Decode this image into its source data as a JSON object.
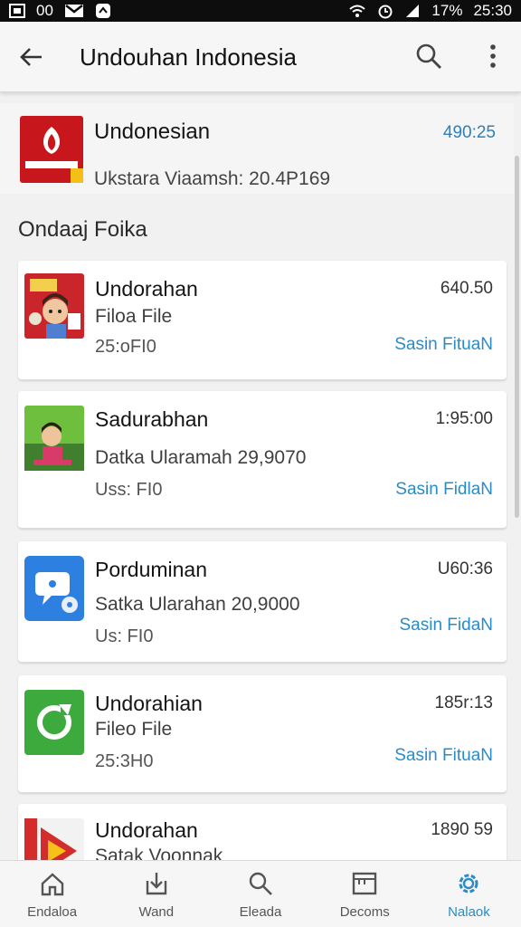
{
  "status_bar": {
    "left_text": "00",
    "battery": "17%",
    "time": "25:30"
  },
  "app_bar": {
    "title": "Undouhan Indonesia"
  },
  "header": {
    "title": "Undonesian",
    "time": "490:25",
    "subtitle": "Ukstara Viaamsh: 20.4P169"
  },
  "section": {
    "title": "Ondaaj Foika"
  },
  "items": [
    {
      "title": "Undorahan",
      "time": "640.50",
      "line2": "Filoa File",
      "line3": "25:oFI0",
      "action": "Sasin FituaN"
    },
    {
      "title": "Sadurabhan",
      "time": "1:95:00",
      "line2": "Datka Ularamah 29,9070",
      "line3": "Uss: FI0",
      "action": "Sasin FidlaN"
    },
    {
      "title": "Porduminan",
      "time": "U60:36",
      "line2": "Satka Ularahan 20,9000",
      "line3": "Us: FI0",
      "action": "Sasin FidaN"
    },
    {
      "title": "Undorahian",
      "time": "185r:13",
      "line2": "Fileo File",
      "line3": "25:3H0",
      "action": "Sasin FituaN"
    },
    {
      "title": "Undorahan",
      "time": "1890 59",
      "line2": "Satak Voonnak",
      "line3": "",
      "action": ""
    }
  ],
  "bottom_nav": [
    {
      "label": "Endaloa",
      "icon": "home-icon"
    },
    {
      "label": "Wand",
      "icon": "download-icon"
    },
    {
      "label": "Eleada",
      "icon": "search-icon"
    },
    {
      "label": "Decoms",
      "icon": "document-icon"
    },
    {
      "label": "Nalaok",
      "icon": "settings-icon"
    }
  ],
  "colors": {
    "accent": "#2a8cc6",
    "status_bar_bg": "#0d0d0d",
    "header_icon_red": "#c8161d",
    "green_icon": "#3caa3c",
    "blue_icon": "#2d7fe0"
  }
}
